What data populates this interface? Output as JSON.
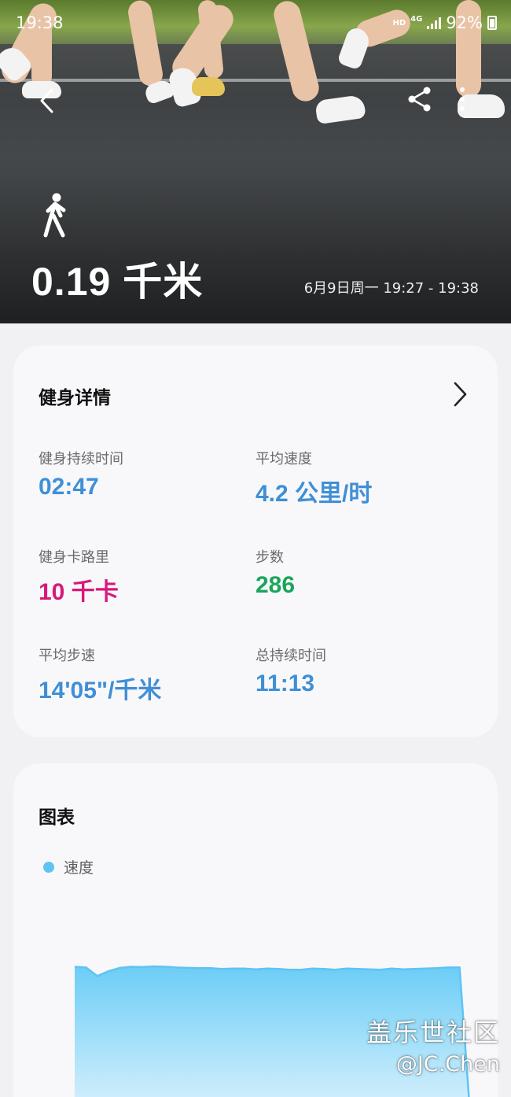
{
  "status_bar": {
    "time": "19:38",
    "hd": "HD",
    "network": "4G",
    "battery": "92%"
  },
  "workout": {
    "activity_icon": "walking-person-icon",
    "distance": "0.19 千米",
    "time_range": "6月9日周一 19:27 - 19:38"
  },
  "details": {
    "title": "健身详情",
    "metrics": [
      {
        "label": "健身持续时间",
        "value": "02:47",
        "color": "#3f8fd6"
      },
      {
        "label": "平均速度",
        "value": "4.2 公里/时",
        "color": "#3f8fd6"
      },
      {
        "label": "健身卡路里",
        "value": "10 千卡",
        "color": "#d8197a"
      },
      {
        "label": "步数",
        "value": "286",
        "color": "#1aa55a"
      },
      {
        "label": "平均步速",
        "value": "14'05\"/千米",
        "color": "#3f8fd6"
      },
      {
        "label": "总持续时间",
        "value": "11:13",
        "color": "#3f8fd6"
      }
    ]
  },
  "chart_card": {
    "title": "图表",
    "legend_label": "速度",
    "legend_color": "#5fc3f3"
  },
  "chart_data": {
    "type": "area",
    "series": [
      {
        "name": "速度",
        "color": "#5fc3f3",
        "values": [
          4.3,
          4.28,
          4.05,
          4.18,
          4.27,
          4.3,
          4.29,
          4.31,
          4.3,
          4.28,
          4.27,
          4.26,
          4.26,
          4.24,
          4.25,
          4.25,
          4.23,
          4.25,
          4.24,
          4.22,
          4.22,
          4.25,
          4.24,
          4.22,
          4.25,
          4.24,
          4.23,
          4.22,
          4.25,
          4.23,
          4.24,
          4.25,
          4.26,
          4.28,
          4.28,
          0.0
        ]
      }
    ],
    "xlabel": "",
    "ylabel": "",
    "grid": false
  },
  "watermark": {
    "line1": "盖乐世社区",
    "line2": "@JC.Chen"
  },
  "icons": {
    "back": "back-arrow-icon",
    "share": "share-icon",
    "more": "more-vertical-icon",
    "chevron": "chevron-right-icon"
  }
}
